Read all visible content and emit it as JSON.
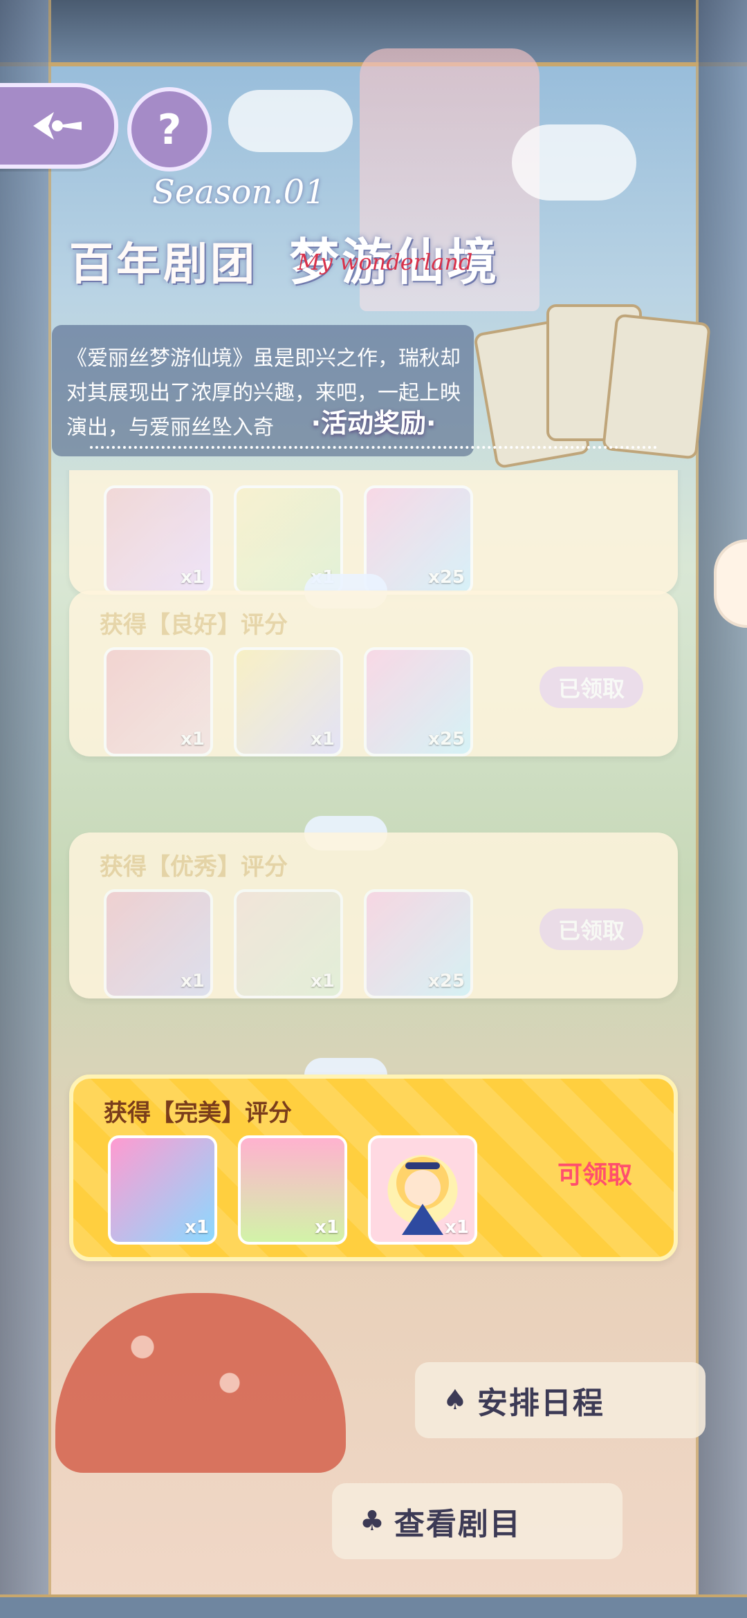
{
  "header": {
    "logo_main": "百年剧团",
    "logo_sub_main": "梦游仙境",
    "logo_season": "Season.01",
    "logo_english": "My wonderland"
  },
  "description": "《爱丽丝梦游仙境》虽是即兴之作，瑞秋却对其展现出了浓厚的兴趣，来吧，一起上映演出，与爱丽丝坠入奇",
  "section_title": "·活动奖励·",
  "rewards": [
    {
      "title": "获得【良好】评分",
      "status": "已领取",
      "items": [
        {
          "qty": "x1",
          "icon": "stage-curtain-icon"
        },
        {
          "qty": "x1",
          "icon": "carpet-icon"
        },
        {
          "qty": "x25",
          "icon": "rainbow-star-icon"
        }
      ]
    },
    {
      "title": "获得【优秀】评分",
      "status": "已领取",
      "items": [
        {
          "qty": "x1",
          "icon": "night-stage-icon"
        },
        {
          "qty": "x1",
          "icon": "flower-frame-icon"
        },
        {
          "qty": "x25",
          "icon": "rainbow-star-icon"
        }
      ]
    },
    {
      "title": "获得【完美】评分",
      "status": "可领取",
      "items": [
        {
          "qty": "x1",
          "icon": "poster-icon"
        },
        {
          "qty": "x1",
          "icon": "green-mat-icon"
        },
        {
          "qty": "x1",
          "icon": "alice-avatar-icon"
        }
      ]
    }
  ],
  "top_card_items": [
    {
      "qty": "x1"
    },
    {
      "qty": "x1"
    },
    {
      "qty": "x25"
    }
  ],
  "actions": {
    "schedule": "安排日程",
    "schedule_sym": "♠",
    "view": "查看剧目",
    "view_sym": "♣"
  },
  "colors": {
    "accent_purple": "#a58bc7",
    "claimable": "#ff4f6d",
    "gold": "#ffd65a"
  }
}
